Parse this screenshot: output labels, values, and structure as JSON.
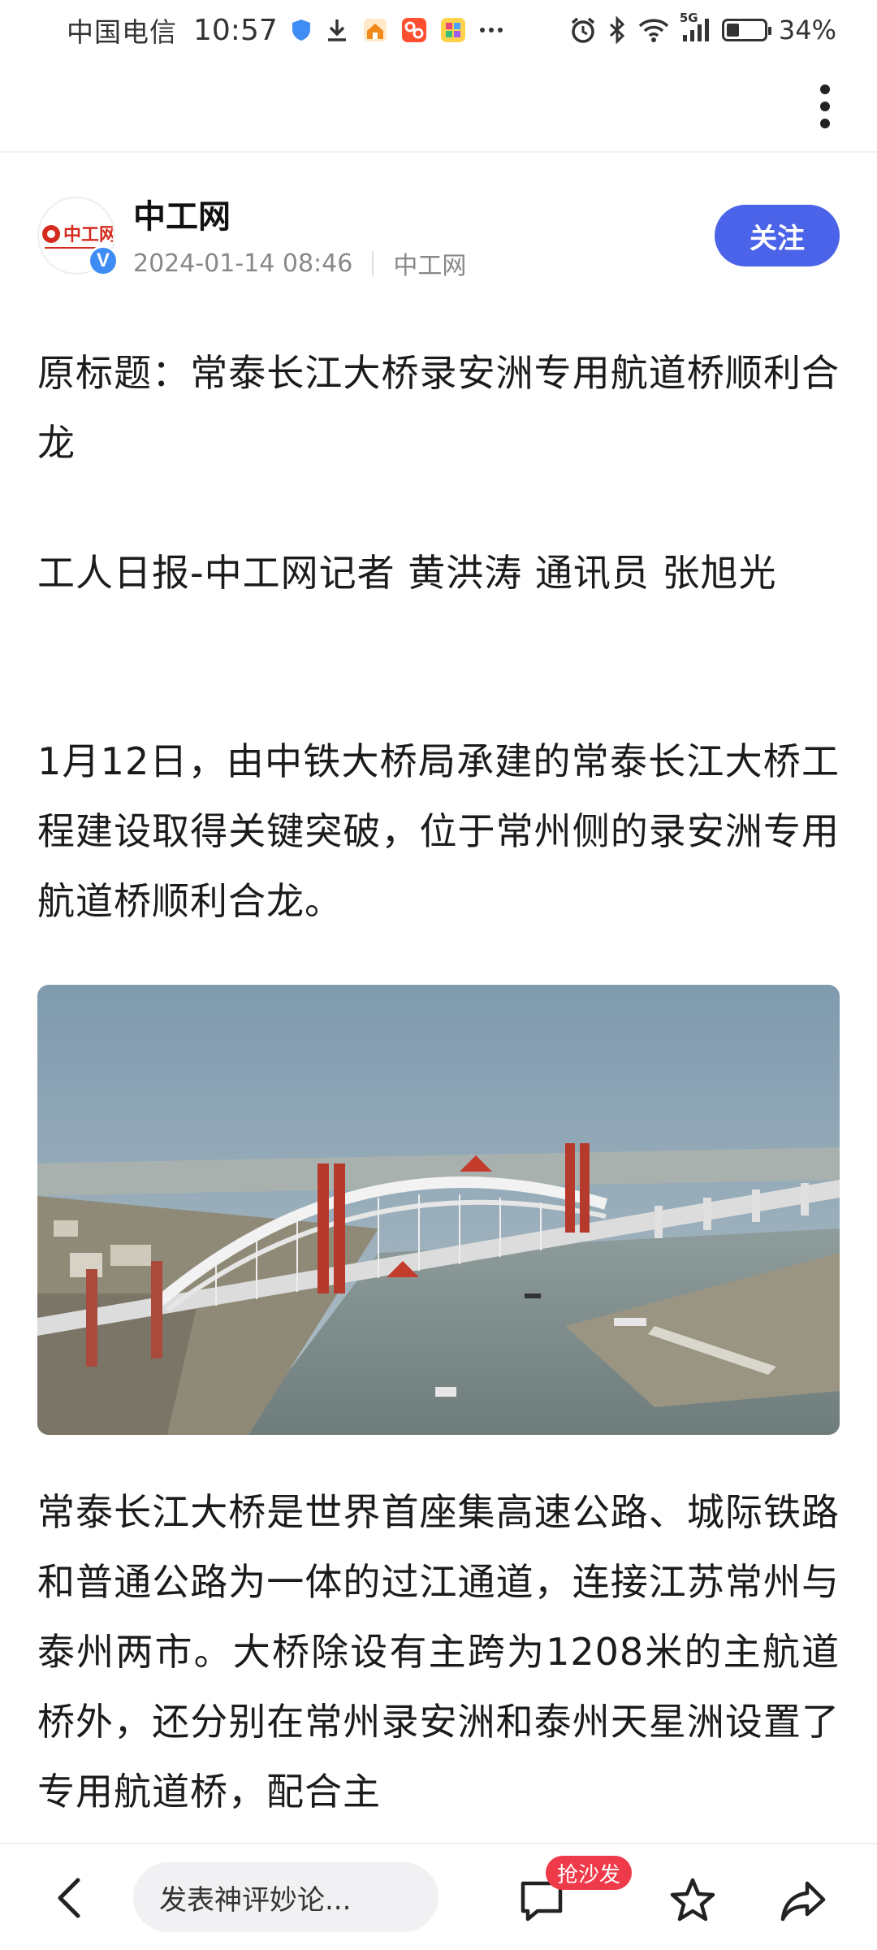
{
  "status_bar": {
    "carrier": "中国电信",
    "time": "10:57",
    "network": "5G",
    "battery": "34%",
    "battery_level": 0.34
  },
  "author": {
    "logo_text": "中工网",
    "name": "中工网",
    "date": "2024-01-14 08:46",
    "source": "中工网",
    "verified_mark": "V",
    "follow_label": "关注"
  },
  "article": {
    "paragraphs": [
      "原标题：常泰长江大桥录安洲专用航道桥顺利合龙",
      "工人日报-中工网记者 黄洪涛 通讯员 张旭光",
      "1月12日，由中铁大桥局承建的常泰长江大桥工程建设取得关键突破，位于常州侧的录安洲专用航道桥顺利合龙。",
      "常泰长江大桥是世界首座集高速公路、城际铁路和普通公路为一体的过江通道，连接江苏常州与泰州两市。大桥除设有主跨为1208米的主航道桥外，还分别在常州录安洲和泰州天星洲设置了专用航道桥，配合主"
    ]
  },
  "bottom_bar": {
    "comment_placeholder": "发表神评妙论...",
    "sofa_badge": "抢沙发"
  },
  "icons": {
    "status": [
      "shield-icon",
      "download-icon",
      "house-icon",
      "app-icon",
      "app-icon-2",
      "more-dots-icon",
      "alarm-icon",
      "bluetooth-icon",
      "wifi-icon",
      "signal-icon",
      "battery-icon"
    ],
    "nav": [
      "more-vertical-icon",
      "back-arrow-icon",
      "comment-icon",
      "star-icon",
      "share-icon"
    ]
  },
  "colors": {
    "accent": "#4a63e8",
    "badge_red": "#ef3a4a",
    "verified_blue": "#3f8cf5"
  }
}
